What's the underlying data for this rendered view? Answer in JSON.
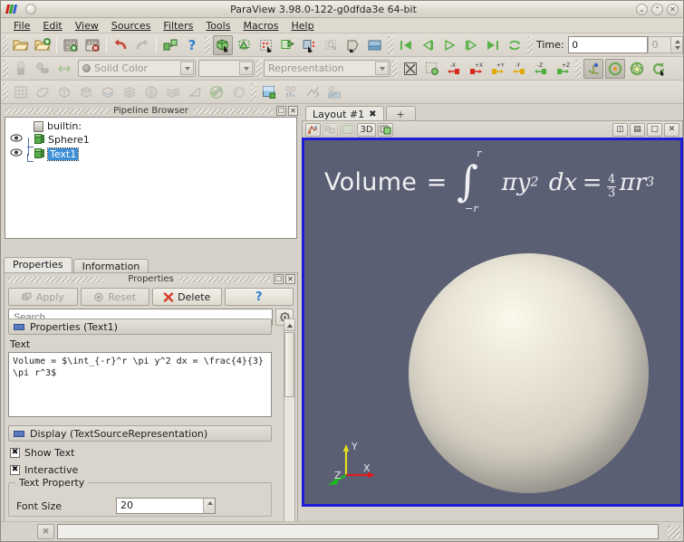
{
  "window": {
    "title": "ParaView 3.98.0-122-g0dfda3e 64-bit",
    "app_icon": "paraview-logo-icon",
    "buttons": [
      {
        "name": "minimize-button",
        "glyph": "⌄"
      },
      {
        "name": "maximize-button",
        "glyph": "⌃"
      },
      {
        "name": "close-button",
        "glyph": "✕"
      }
    ]
  },
  "menubar": {
    "items": [
      {
        "label": "File",
        "mnemonic": "F"
      },
      {
        "label": "Edit",
        "mnemonic": "E"
      },
      {
        "label": "View",
        "mnemonic": "V"
      },
      {
        "label": "Sources",
        "mnemonic": "S"
      },
      {
        "label": "Filters",
        "mnemonic": "F"
      },
      {
        "label": "Tools",
        "mnemonic": "T"
      },
      {
        "label": "Macros",
        "mnemonic": "M"
      },
      {
        "label": "Help",
        "mnemonic": "H"
      }
    ]
  },
  "toolbar_main": {
    "time_label": "Time:",
    "time_value": "0",
    "time_index": "0",
    "buttons": [
      "open-file-icon",
      "open-recent-icon",
      "save-state-icon",
      "load-state-icon",
      "undo-icon",
      "redo-icon",
      "connect-server-icon",
      "help-icon",
      "select-surface-cells-icon",
      "select-surface-points-icon",
      "select-frustum-cells-icon",
      "select-frustum-points-icon",
      "select-blocks-icon",
      "interactive-select-icon",
      "hover-points-icon",
      "plot-over-selection-icon",
      "extract-selection-icon"
    ],
    "vcr_buttons": [
      "first-frame-icon",
      "previous-frame-icon",
      "play-icon",
      "next-frame-icon",
      "last-frame-icon",
      "loop-icon"
    ]
  },
  "toolbar_repr": {
    "color_by_value": "Solid Color",
    "array_component_value": "",
    "representation_value": "Representation",
    "buttons": [
      "edit-color-map-icon",
      "rescale-to-data-range-icon",
      "rescale-custom-range-icon"
    ],
    "camera_buttons": [
      "reset-camera-icon",
      "zoom-to-box-icon",
      "neg-x-view-icon",
      "pos-x-view-icon",
      "pos-y-view-icon",
      "neg-y-view-icon",
      "neg-z-view-icon",
      "pos-z-view-icon"
    ],
    "rotate_buttons": [
      "center-axes-icon",
      "show-center-icon",
      "pick-center-icon",
      "rotate-90-icon"
    ]
  },
  "toolbar_filters": {
    "buttons": [
      "spreadsheet-icon",
      "calculator-icon",
      "contour-icon",
      "clip-icon",
      "slice-icon",
      "threshold-icon",
      "extract-subset-icon",
      "glyph-icon",
      "stream-tracer-icon",
      "warp-icon",
      "group-datasets-icon",
      "extract-level-icon",
      "color-legend-icon",
      "histogram-icon",
      "plot-data-icon",
      "chart-icon"
    ]
  },
  "pipeline_browser": {
    "title": "Pipeline Browser",
    "dock_buttons": [
      "undock-icon",
      "close-icon"
    ],
    "items": [
      {
        "label": "builtin:",
        "icon": "server-icon",
        "visible": null,
        "selected": false,
        "indent": 0
      },
      {
        "label": "Sphere1",
        "icon": "source-cube-icon",
        "visible": true,
        "selected": false,
        "indent": 1
      },
      {
        "label": "Text1",
        "icon": "source-cube-icon",
        "visible": true,
        "selected": true,
        "indent": 1
      }
    ]
  },
  "properties_dock": {
    "title": "Properties",
    "dock_buttons": [
      "undock-icon",
      "close-icon"
    ],
    "tabs": [
      {
        "label": "Properties",
        "active": true
      },
      {
        "label": "Information",
        "active": false
      }
    ],
    "action_buttons": [
      {
        "label": "Apply",
        "icon": "apply-icon",
        "enabled": false
      },
      {
        "label": "Reset",
        "icon": "reset-icon",
        "enabled": false
      },
      {
        "label": "Delete",
        "icon": "delete-x-icon",
        "enabled": true
      },
      {
        "label": "?",
        "icon": "help-question-icon",
        "enabled": true
      }
    ],
    "search_placeholder": "Search...",
    "gear_icon": "advanced-properties-gear-icon",
    "groups": [
      {
        "header": "Properties (Text1)",
        "field_label": "Text",
        "text_value": "Volume = $\\int_{-r}^r \\pi y^2 dx = \\frac{4}{3}\\pi r^3$"
      },
      {
        "header": "Display (TextSourceRepresentation)",
        "checkboxes": [
          {
            "label": "Show Text",
            "checked": true
          },
          {
            "label": "Interactive",
            "checked": true
          }
        ],
        "group_caption": "Text Property",
        "font_size_label": "Font Size",
        "font_size_value": "20"
      }
    ]
  },
  "layout": {
    "tabs": [
      {
        "label": "Layout #1",
        "closable": true
      },
      {
        "label": "+",
        "closable": false
      }
    ],
    "view_toolbar": {
      "buttons": [
        {
          "name": "interaction-mode-icon",
          "label": ""
        },
        {
          "name": "camera-undo-icon",
          "label": ""
        },
        {
          "name": "show-color-legend-icon",
          "label": ""
        },
        {
          "name": "view-type-button",
          "label": "3D"
        },
        {
          "name": "capture-screenshot-icon",
          "label": ""
        }
      ],
      "right_buttons": [
        {
          "name": "split-horizontal-icon",
          "label": "◫"
        },
        {
          "name": "split-vertical-icon",
          "label": "▤"
        },
        {
          "name": "maximize-view-icon",
          "label": "□"
        },
        {
          "name": "close-view-icon",
          "label": "✕"
        }
      ]
    }
  },
  "render_view": {
    "background_color": "#5a5f74",
    "sphere_color": "#e8e3d4",
    "border_color": "#1d1dd8",
    "formula": {
      "lhs": "Volume",
      "equals": "=",
      "integral_lower": "−r",
      "integral_upper": "r",
      "integrand": "πy",
      "integrand_exp": "2",
      "differential": "dx",
      "equals2": "=",
      "frac_numerator": "4",
      "frac_denominator": "3",
      "rhs_tail": "πr",
      "rhs_exp": "3"
    },
    "axes": [
      {
        "label": "X",
        "color": "#e01b1b"
      },
      {
        "label": "Y",
        "color": "#e8e020"
      },
      {
        "label": "Z",
        "color": "#15c015"
      }
    ]
  },
  "statusbar": {
    "abort_icon": "abort-icon",
    "progress_value": ""
  }
}
